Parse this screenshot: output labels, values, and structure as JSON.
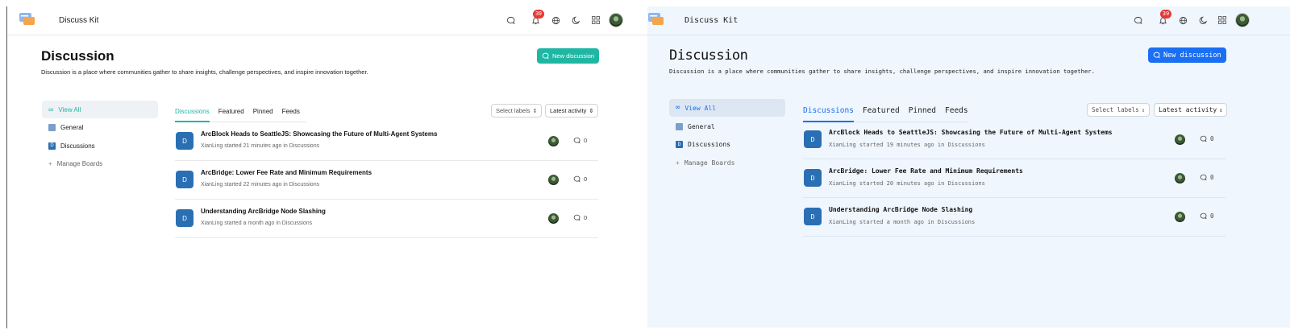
{
  "app": {
    "brand": "Discuss Kit",
    "notification_count": "39"
  },
  "page": {
    "title": "Discussion",
    "description": "Discussion is a place where communities gather to share insights, challenge perspectives, and inspire innovation together.",
    "new_button": "New discussion"
  },
  "sidebar": {
    "items": [
      {
        "label": "View All",
        "icon": "infinity-icon"
      },
      {
        "label": "General",
        "icon": "board-icon"
      },
      {
        "label": "Discussions",
        "icon": "board-d-icon",
        "letter": "D"
      },
      {
        "label": "Manage Boards",
        "icon": "plus-icon"
      }
    ]
  },
  "tabs": [
    "Discussions",
    "Featured",
    "Pinned",
    "Feeds"
  ],
  "filters": {
    "labels_placeholder": "Select labels",
    "sort": "Latest activity"
  },
  "list_left": [
    {
      "avatar": "D",
      "title": "ArcBlock Heads to SeattleJS: Showcasing the Future of Multi-Agent Systems",
      "meta": "XianLing started 21 minutes ago in Discussions",
      "comments": "0"
    },
    {
      "avatar": "D",
      "title": "ArcBridge: Lower Fee Rate and Minimum Requirements",
      "meta": "XianLing started 22 minutes ago in Discussions",
      "comments": "0"
    },
    {
      "avatar": "D",
      "title": "Understanding ArcBridge Node Slashing",
      "meta": "XianLing started a month ago in Discussions",
      "comments": "0"
    }
  ],
  "list_right": [
    {
      "avatar": "D",
      "title": "ArcBlock Heads to SeattleJS: Showcasing the Future of Multi-Agent Systems",
      "meta": "XianLing started 19 minutes ago in Discussions",
      "comments": "0"
    },
    {
      "avatar": "D",
      "title": "ArcBridge: Lower Fee Rate and Minimum Requirements",
      "meta": "XianLing started 20 minutes ago in Discussions",
      "comments": "0"
    },
    {
      "avatar": "D",
      "title": "Understanding ArcBridge Node Slashing",
      "meta": "XianLing started a month ago in Discussions",
      "comments": "0"
    }
  ],
  "theme": {
    "left_accent": "#1fb7a3",
    "right_accent": "#1a6ff2",
    "left_bg": "#ffffff",
    "right_bg": "#eff6fd",
    "badge": "#e53935"
  }
}
